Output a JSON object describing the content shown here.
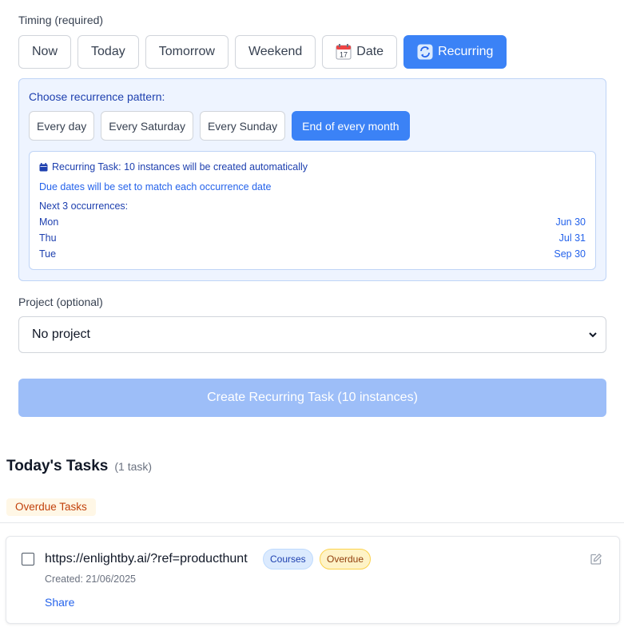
{
  "timing": {
    "label": "Timing (required)",
    "options": [
      {
        "label": "Now"
      },
      {
        "label": "Today"
      },
      {
        "label": "Tomorrow"
      },
      {
        "label": "Weekend"
      },
      {
        "label": "Date",
        "icon": "calendar-icon"
      },
      {
        "label": "Recurring",
        "icon": "repeat-icon",
        "active": true
      }
    ]
  },
  "recurrence": {
    "title": "Choose recurrence pattern:",
    "patterns": [
      {
        "label": "Every day"
      },
      {
        "label": "Every Saturday"
      },
      {
        "label": "Every Sunday"
      },
      {
        "label": "End of every month",
        "active": true
      }
    ],
    "info": {
      "headline": "Recurring Task: 10 instances will be created automatically",
      "due_note": "Due dates will be set to match each occurrence date",
      "next_label": "Next 3 occurrences:",
      "occurrences": [
        {
          "day": "Mon",
          "date": "Jun 30"
        },
        {
          "day": "Thu",
          "date": "Jul 31"
        },
        {
          "day": "Tue",
          "date": "Sep 30"
        }
      ]
    }
  },
  "project": {
    "label": "Project (optional)",
    "selected": "No project"
  },
  "create_button": "Create Recurring Task (10 instances)",
  "tasks": {
    "title": "Today's Tasks",
    "count": "(1 task)",
    "group_label": "Overdue Tasks",
    "items": [
      {
        "text": "https://enlightby.ai/?ref=producthunt",
        "category": "Courses",
        "status": "Overdue",
        "created": "Created: 21/06/2025",
        "share": "Share"
      }
    ]
  },
  "colors": {
    "accent": "#3b82f6",
    "accent_disabled": "#9dbef8",
    "panel_bg": "#eef4ff",
    "info_text": "#1e40af",
    "overdue_bg": "#fef3c7"
  }
}
